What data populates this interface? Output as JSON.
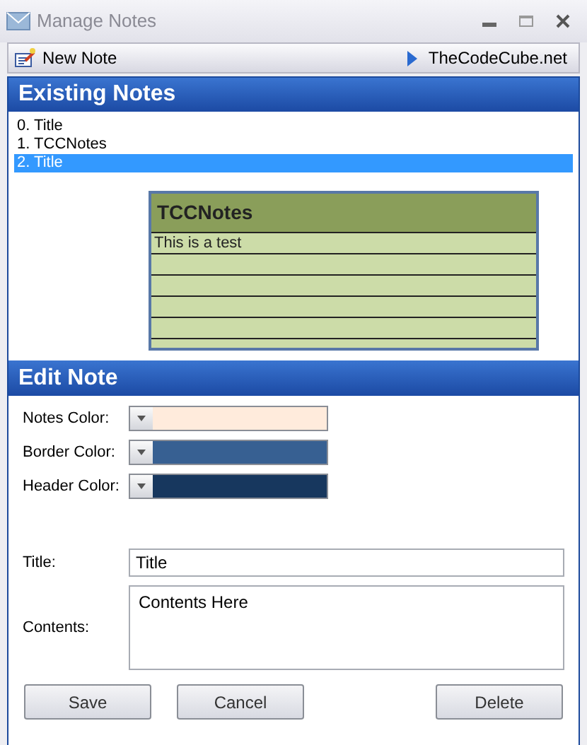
{
  "window": {
    "title": "Manage Notes"
  },
  "toolbar": {
    "new_note": "New Note",
    "link": "TheCodeCube.net"
  },
  "existing_notes": {
    "heading": "Existing Notes",
    "items": [
      {
        "label": "0. Title",
        "selected": false
      },
      {
        "label": "1. TCCNotes",
        "selected": false
      },
      {
        "label": "2. Title",
        "selected": true
      }
    ],
    "preview": {
      "title": "TCCNotes",
      "lines": [
        "This is a test"
      ]
    }
  },
  "edit_note": {
    "heading": "Edit Note",
    "colors": [
      {
        "label": "Notes Color:",
        "color": "#ffebdc"
      },
      {
        "label": "Border Color:",
        "color": "#376092"
      },
      {
        "label": "Header Color:",
        "color": "#17375e"
      }
    ],
    "title_label": "Title:",
    "title_value": "Title",
    "contents_label": "Contents:",
    "contents_value": "Contents Here",
    "buttons": [
      "Save",
      "Cancel",
      "Delete"
    ]
  }
}
